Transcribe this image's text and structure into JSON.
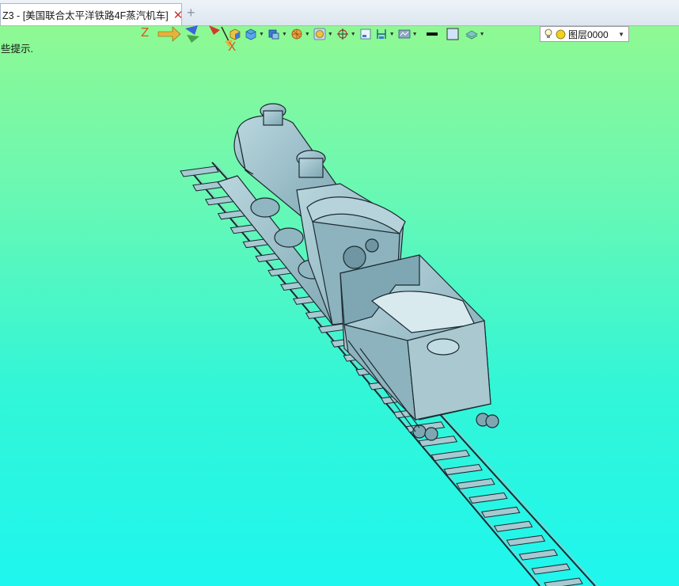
{
  "window": {
    "tab_title": "Z3 - [美国联合太平洋铁路4F蒸汽机车]",
    "close_glyph": "✕",
    "new_tab_glyph": "+"
  },
  "status": {
    "hint": "些提示."
  },
  "triad": {
    "z_label": "Z",
    "x_label": "X"
  },
  "toolbar": {
    "tools": [
      "shaded-box-icon",
      "view-cube-icon",
      "shade-mode-icon",
      "render-icon",
      "display-style-icon",
      "snap-icon",
      "frame-icon",
      "align-icon",
      "filter-icon",
      "line-color-icon",
      "fill-color-icon",
      "layer-stack-icon"
    ]
  },
  "layer": {
    "name": "图层0000"
  },
  "colors": {
    "bg_top": "#94f98d",
    "bg_bottom": "#1ef6ee",
    "model": "#9fc4cf",
    "model_edge": "#1a2b31"
  }
}
